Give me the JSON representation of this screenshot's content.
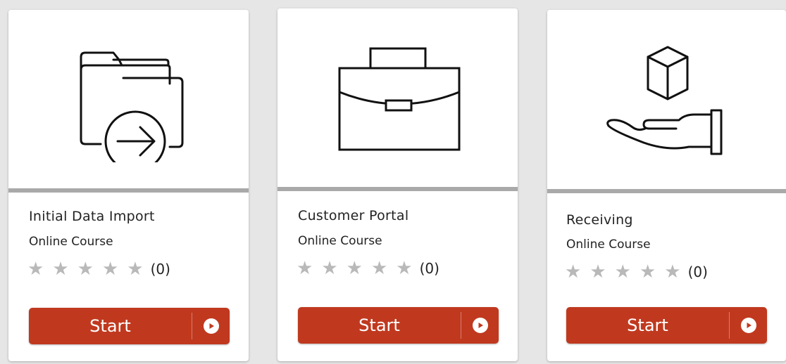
{
  "courses": [
    {
      "title": "Initial Data Import",
      "type": "Online Course",
      "rating_stars": 0,
      "rating_count": "(0)",
      "button_label": "Start",
      "icon": "folder-arrow-icon"
    },
    {
      "title": "Customer Portal",
      "type": "Online Course",
      "rating_stars": 0,
      "rating_count": "(0)",
      "button_label": "Start",
      "icon": "briefcase-icon"
    },
    {
      "title": "Receiving",
      "type": "Online Course",
      "rating_stars": 0,
      "rating_count": "(0)",
      "button_label": "Start",
      "icon": "box-hand-icon"
    }
  ],
  "colors": {
    "accent": "#c0391f",
    "divider": "#a9a9a9",
    "star_empty": "#b9b9b9",
    "background": "#e6e6e6"
  }
}
